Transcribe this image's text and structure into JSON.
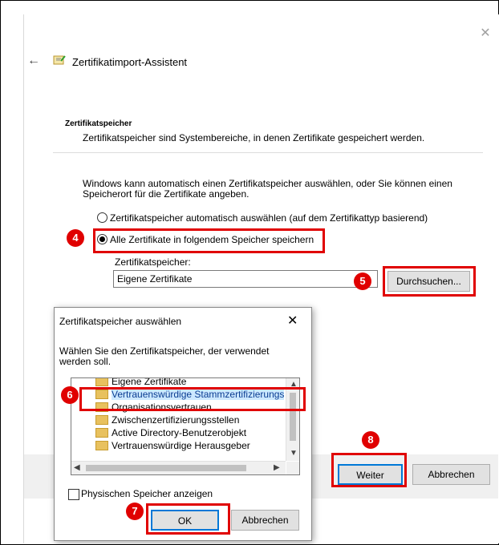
{
  "wizard": {
    "title": "Zertifikatimport-Assistent",
    "section_title": "Zertifikatspeicher",
    "section_desc": "Zertifikatspeicher sind Systembereiche, in denen Zertifikate gespeichert werden.",
    "info_text": "Windows kann automatisch einen Zertifikatspeicher auswählen, oder Sie können einen Speicherort für die Zertifikate angeben.",
    "radio_auto_label": "Zertifikatspeicher automatisch auswählen (auf dem Zertifikattyp basierend)",
    "radio_manual_label": "Alle Zertifikate in folgendem Speicher speichern",
    "store_label": "Zertifikatspeicher:",
    "store_value": "Eigene Zertifikate",
    "browse_label": "Durchsuchen...",
    "next_label": "Weiter",
    "cancel_label": "Abbrechen"
  },
  "dialog": {
    "title": "Zertifikatspeicher auswählen",
    "close": "✕",
    "desc": "Wählen Sie den Zertifikatspeicher, der verwendet werden soll.",
    "items": [
      "Eigene Zertifikate",
      "Vertrauenswürdige Stammzertifizierungs",
      "Organisationsvertrauen",
      "Zwischenzertifizierungsstellen",
      "Active Directory-Benutzerobjekt",
      "Vertrauenswürdige Herausgeber"
    ],
    "checkbox_label": "Physischen Speicher anzeigen",
    "ok_label": "OK",
    "cancel_label": "Abbrechen"
  },
  "annotations": {
    "step4": "4",
    "step5": "5",
    "step6": "6",
    "step7": "7",
    "step8": "8",
    "highlight_color": "#e00000"
  },
  "icons": {
    "back": "back-arrow-icon",
    "wizard": "certificate-icon",
    "close": "close-icon",
    "folder": "folder-icon"
  }
}
